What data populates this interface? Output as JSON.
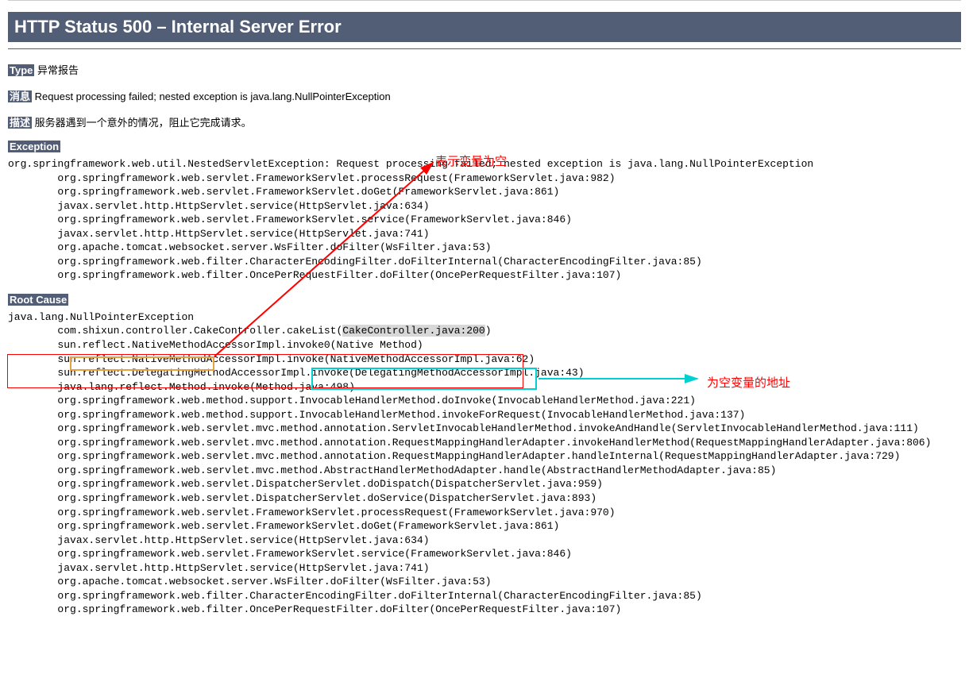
{
  "header": {
    "title": "HTTP Status 500 – Internal Server Error"
  },
  "labels": {
    "type": "Type",
    "message": "消息",
    "description": "描述",
    "exception": "Exception",
    "rootCause": "Root Cause"
  },
  "fields": {
    "typeValue": "异常报告",
    "messageValue": "Request processing failed; nested exception is java.lang.NullPointerException",
    "descriptionValue": "服务器遇到一个意外的情况，阻止它完成请求。"
  },
  "exceptionTrace": "org.springframework.web.util.NestedServletException: Request processing failed; nested exception is java.lang.NullPointerException\n\torg.springframework.web.servlet.FrameworkServlet.processRequest(FrameworkServlet.java:982)\n\torg.springframework.web.servlet.FrameworkServlet.doGet(FrameworkServlet.java:861)\n\tjavax.servlet.http.HttpServlet.service(HttpServlet.java:634)\n\torg.springframework.web.servlet.FrameworkServlet.service(FrameworkServlet.java:846)\n\tjavax.servlet.http.HttpServlet.service(HttpServlet.java:741)\n\torg.apache.tomcat.websocket.server.WsFilter.doFilter(WsFilter.java:53)\n\torg.springframework.web.filter.CharacterEncodingFilter.doFilterInternal(CharacterEncodingFilter.java:85)\n\torg.springframework.web.filter.OncePerRequestFilter.doFilter(OncePerRequestFilter.java:107)",
  "rootCause": {
    "prefix": "java.lang.",
    "exceptionName": "NullPointerException",
    "line2prefix": "\tcom.shixun.controller.CakeController.cakeList(",
    "line2highlight": "CakeController.java:200",
    "line2suffix": ")",
    "rest": "\tsun.reflect.NativeMethodAccessorImpl.invoke0(Native Method)\n\tsun.reflect.NativeMethodAccessorImpl.invoke(NativeMethodAccessorImpl.java:62)\n\tsun.reflect.DelegatingMethodAccessorImpl.invoke(DelegatingMethodAccessorImpl.java:43)\n\tjava.lang.reflect.Method.invoke(Method.java:498)\n\torg.springframework.web.method.support.InvocableHandlerMethod.doInvoke(InvocableHandlerMethod.java:221)\n\torg.springframework.web.method.support.InvocableHandlerMethod.invokeForRequest(InvocableHandlerMethod.java:137)\n\torg.springframework.web.servlet.mvc.method.annotation.ServletInvocableHandlerMethod.invokeAndHandle(ServletInvocableHandlerMethod.java:111)\n\torg.springframework.web.servlet.mvc.method.annotation.RequestMappingHandlerAdapter.invokeHandlerMethod(RequestMappingHandlerAdapter.java:806)\n\torg.springframework.web.servlet.mvc.method.annotation.RequestMappingHandlerAdapter.handleInternal(RequestMappingHandlerAdapter.java:729)\n\torg.springframework.web.servlet.mvc.method.AbstractHandlerMethodAdapter.handle(AbstractHandlerMethodAdapter.java:85)\n\torg.springframework.web.servlet.DispatcherServlet.doDispatch(DispatcherServlet.java:959)\n\torg.springframework.web.servlet.DispatcherServlet.doService(DispatcherServlet.java:893)\n\torg.springframework.web.servlet.FrameworkServlet.processRequest(FrameworkServlet.java:970)\n\torg.springframework.web.servlet.FrameworkServlet.doGet(FrameworkServlet.java:861)\n\tjavax.servlet.http.HttpServlet.service(HttpServlet.java:634)\n\torg.springframework.web.servlet.FrameworkServlet.service(FrameworkServlet.java:846)\n\tjavax.servlet.http.HttpServlet.service(HttpServlet.java:741)\n\torg.apache.tomcat.websocket.server.WsFilter.doFilter(WsFilter.java:53)\n\torg.springframework.web.filter.CharacterEncodingFilter.doFilterInternal(CharacterEncodingFilter.java:85)\n\torg.springframework.web.filter.OncePerRequestFilter.doFilter(OncePerRequestFilter.java:107)"
  },
  "annotations": {
    "top": "表示变量为空",
    "right": "为空变量的地址"
  }
}
